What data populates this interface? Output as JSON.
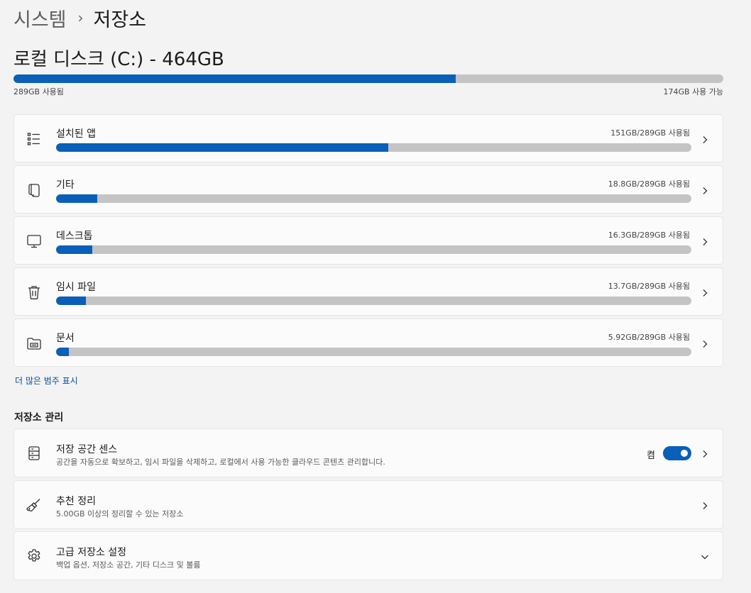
{
  "breadcrumb": {
    "parent": "시스템",
    "current": "저장소"
  },
  "drive": {
    "title": "로컬 디스크 (C:) - 464GB",
    "used_label": "289GB 사용됨",
    "free_label": "174GB 사용 가능",
    "used_fraction": 0.623
  },
  "categories": [
    {
      "label": "설치된 앱",
      "size": "151GB/289GB 사용됨",
      "fraction": 0.523,
      "icon": "apps-list-icon"
    },
    {
      "label": "기타",
      "size": "18.8GB/289GB 사용됨",
      "fraction": 0.065,
      "icon": "other-files-icon"
    },
    {
      "label": "데스크톱",
      "size": "16.3GB/289GB 사용됨",
      "fraction": 0.057,
      "icon": "desktop-icon"
    },
    {
      "label": "임시 파일",
      "size": "13.7GB/289GB 사용됨",
      "fraction": 0.047,
      "icon": "trash-icon"
    },
    {
      "label": "문서",
      "size": "5.92GB/289GB 사용됨",
      "fraction": 0.02,
      "icon": "documents-folder-icon"
    }
  ],
  "more_categories_link": "더 많은 범주 표시",
  "manage": {
    "section_title": "저장소 관리",
    "items": [
      {
        "title": "저장 공간 센스",
        "desc": "공간을 자동으로 확보하고, 임시 파일을 삭제하고, 로컬에서 사용 가능한 클라우드 콘텐츠 관리합니다.",
        "icon": "storage-drive-icon",
        "toggle_label": "켬",
        "toggle_on": true
      },
      {
        "title": "추천 정리",
        "desc": "5.00GB 이상의 정리할 수 있는 저장소",
        "icon": "broom-icon"
      },
      {
        "title": "고급 저장소 설정",
        "desc": "백업 옵션, 저장소 공간, 기타 디스크 및 볼륨",
        "icon": "gear-icon"
      }
    ]
  },
  "colors": {
    "accent": "#0a5fb8",
    "track": "#c4c4c4",
    "background": "#f3f3f3",
    "card": "#fbfbfb"
  }
}
